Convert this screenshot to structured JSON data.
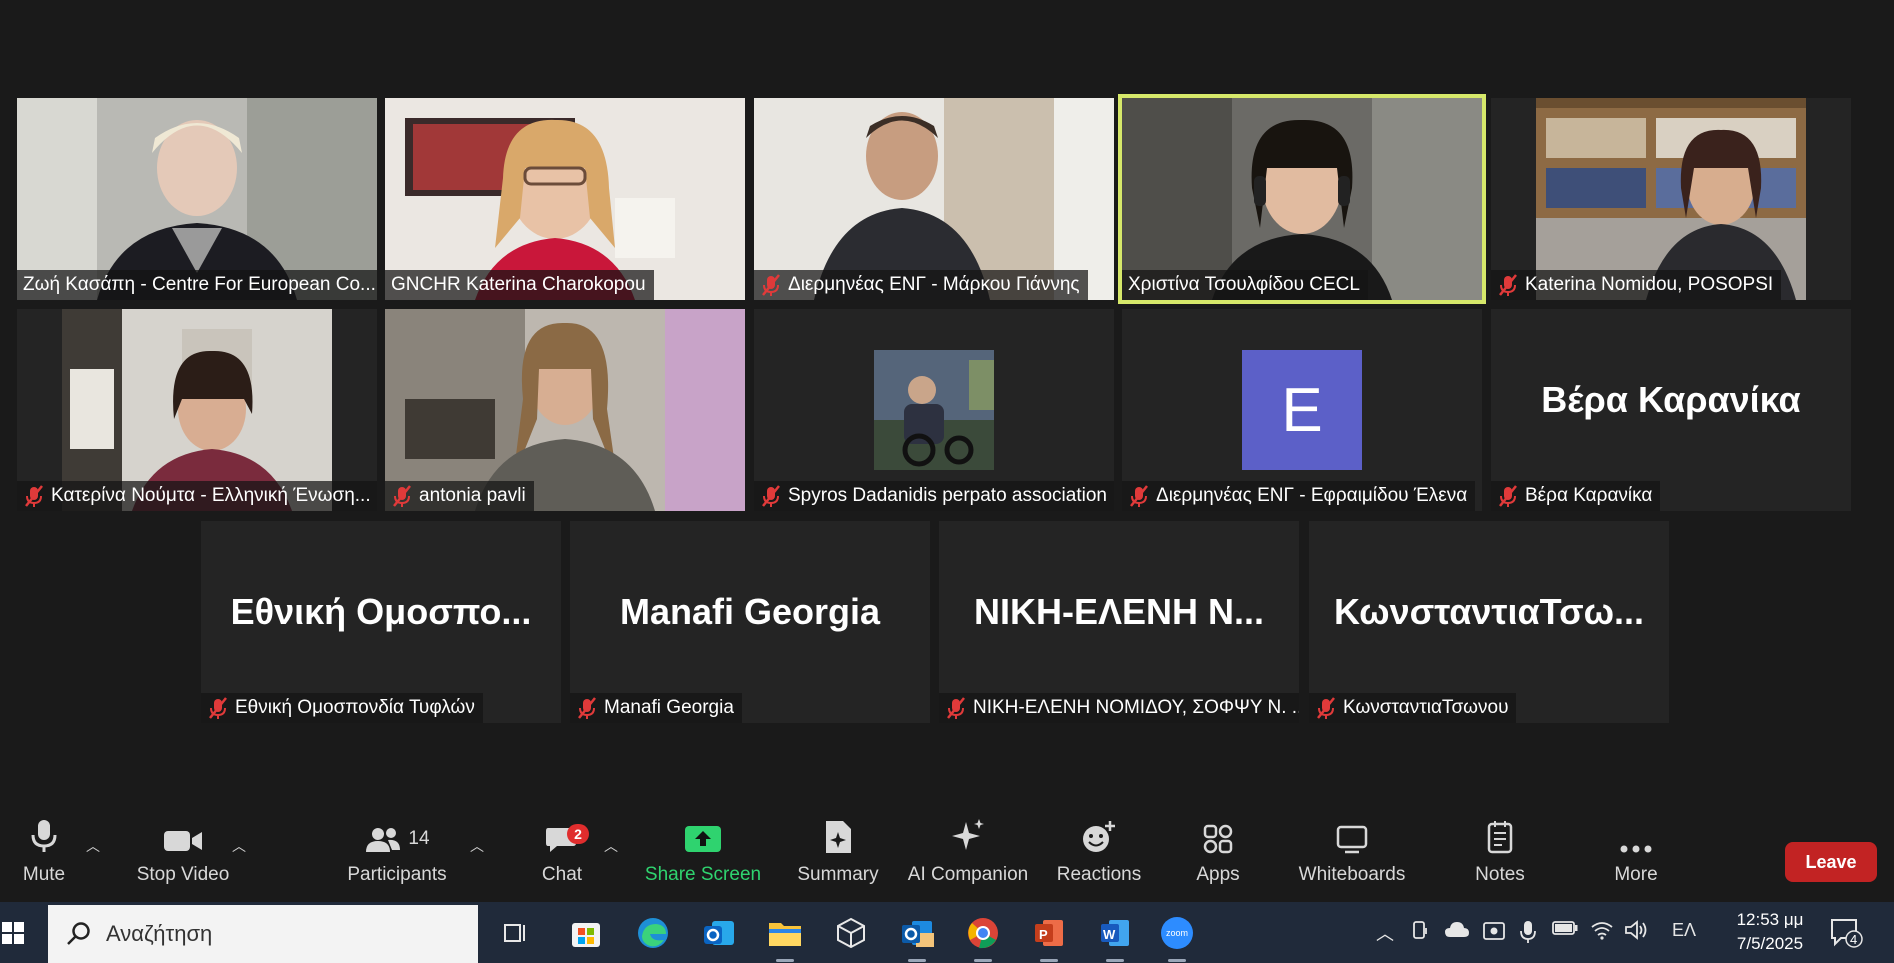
{
  "gallery": {
    "tiles": [
      {
        "name": "Ζωή Κασάπη - Centre For European Co...",
        "muted": false,
        "active": false,
        "kind": "video"
      },
      {
        "name": "GNCHR Katerina Charokopou",
        "muted": false,
        "active": false,
        "kind": "video"
      },
      {
        "name": "Διερμηνέας ENΓ - Μάρκου Γιάννης",
        "muted": true,
        "active": false,
        "kind": "video"
      },
      {
        "name": "Χριστίνα Τσουλφίδου CECL",
        "muted": false,
        "active": true,
        "kind": "video"
      },
      {
        "name": "Katerina Nomidou, POSOPSI",
        "muted": true,
        "active": false,
        "kind": "video"
      },
      {
        "name": "Κατερίνα Νούμτα - Ελληνική Ένωση...",
        "muted": true,
        "active": false,
        "kind": "video"
      },
      {
        "name": "antonia pavli",
        "muted": true,
        "active": false,
        "kind": "video"
      },
      {
        "name": "Spyros Dadanidis perpato association",
        "muted": true,
        "active": false,
        "kind": "photo"
      },
      {
        "name": "Διερμηνέας ENΓ - Εφραιμίδου Έλενα",
        "muted": true,
        "active": false,
        "kind": "avatar",
        "initial": "E"
      },
      {
        "name": "Βέρα Καρανίκα",
        "muted": true,
        "active": false,
        "kind": "text",
        "big": "Βέρα Καρανίκα"
      },
      {
        "name": "Εθνική Ομοσπονδία Τυφλών",
        "muted": true,
        "active": false,
        "kind": "text",
        "big": "Εθνική Ομοσπο..."
      },
      {
        "name": "Manafi Georgia",
        "muted": true,
        "active": false,
        "kind": "text",
        "big": "Manafi Georgia"
      },
      {
        "name": "ΝΙΚΗ-ΕΛΕΝΗ ΝΟΜΙΔΟΥ, ΣΟΦΨΥ Ν. ...",
        "muted": true,
        "active": false,
        "kind": "text",
        "big": "ΝΙΚΗ-ΕΛΕΝΗ  Ν..."
      },
      {
        "name": "ΚωνσταντιαΤσωνου",
        "muted": true,
        "active": false,
        "kind": "text",
        "big": "ΚωνσταντιαΤσω..."
      }
    ]
  },
  "toolbar": {
    "mute": "Mute",
    "stop_video": "Stop Video",
    "participants": "Participants",
    "participants_count": "14",
    "chat": "Chat",
    "chat_badge": "2",
    "share_screen": "Share Screen",
    "summary": "Summary",
    "ai_companion": "AI Companion",
    "reactions": "Reactions",
    "apps": "Apps",
    "whiteboards": "Whiteboards",
    "notes": "Notes",
    "more": "More",
    "leave": "Leave",
    "share_color": "#2fd36f",
    "leave_color": "#c22323"
  },
  "taskbar": {
    "search_placeholder": "Αναζήτηση",
    "language": "ΕΛ",
    "time": "12:53 μμ",
    "date": "7/5/2025",
    "notifications": "4"
  }
}
